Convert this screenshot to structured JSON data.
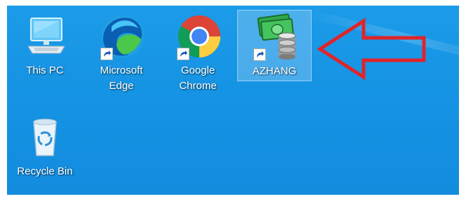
{
  "desktop": {
    "icons": [
      {
        "label": "This PC",
        "icon": "this-pc-icon"
      },
      {
        "label": "Microsoft\nEdge",
        "icon": "edge-icon"
      },
      {
        "label": "Google\nChrome",
        "icon": "chrome-icon"
      },
      {
        "label": "AZHANG",
        "icon": "money-database-icon",
        "selected": true
      },
      {
        "label": "Recycle Bin",
        "icon": "recycle-bin-icon"
      }
    ],
    "annotation": {
      "color": "#e0242a",
      "icon": "red-arrow-icon"
    }
  }
}
